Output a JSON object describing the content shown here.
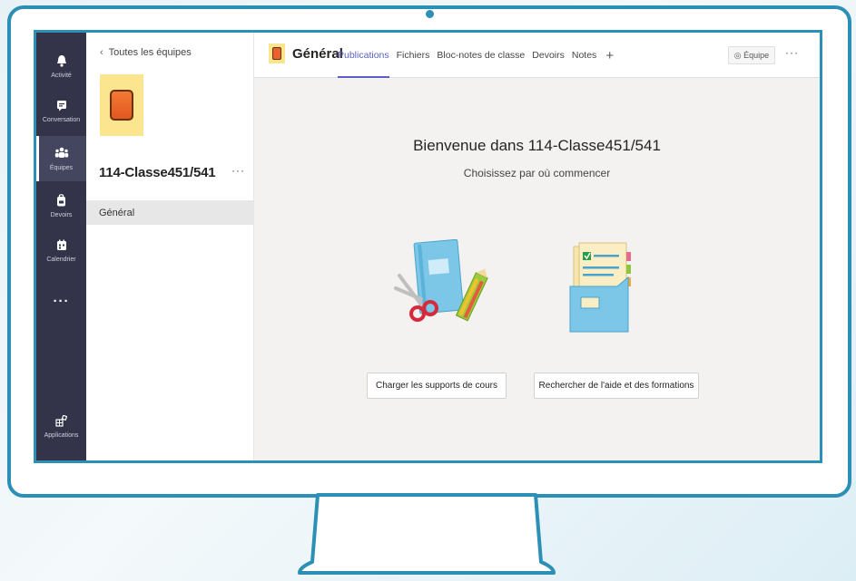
{
  "rail": {
    "items": [
      {
        "label": "Activité",
        "icon": "bell-icon"
      },
      {
        "label": "Conversation",
        "icon": "chat-icon"
      },
      {
        "label": "Équipes",
        "icon": "teams-icon"
      },
      {
        "label": "Devoirs",
        "icon": "backpack-icon"
      },
      {
        "label": "Calendrier",
        "icon": "calendar-icon"
      }
    ],
    "more": "···",
    "apps_label": "Applications"
  },
  "teampane": {
    "back_label": "Toutes les équipes",
    "team_name": "114-Classe451/541",
    "more": "···",
    "channel": "Général"
  },
  "header": {
    "channel_title": "Général",
    "tabs": [
      "Publications",
      "Fichiers",
      "Bloc-notes de classe",
      "Devoirs",
      "Notes"
    ],
    "add": "+",
    "team_button": "◎ Équipe",
    "more": "···"
  },
  "main": {
    "welcome": "Bienvenue dans 114-Classe451/541",
    "subtitle": "Choisissez par où commencer",
    "button_upload": "Charger les supports de cours",
    "button_help": "Rechercher de l'aide et des formations"
  },
  "colors": {
    "frame": "#2b8fb6",
    "rail": "#33344a",
    "accent": "#5b5fc7",
    "team_tile": "#fbe58f",
    "team_logo": "#e8622a"
  }
}
